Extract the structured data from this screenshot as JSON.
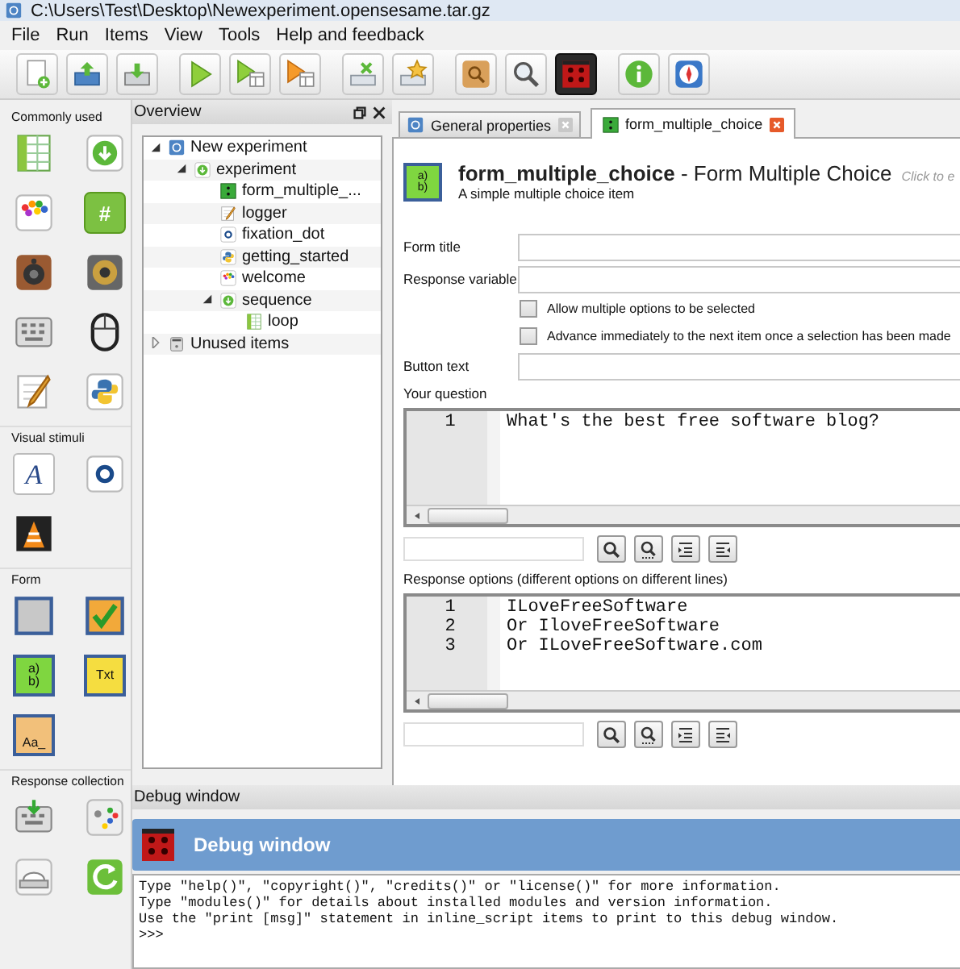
{
  "window": {
    "title": "C:\\Users\\Test\\Desktop\\Newexperiment.opensesame.tar.gz"
  },
  "menu": [
    "File",
    "Run",
    "Items",
    "View",
    "Tools",
    "Help and feedback"
  ],
  "toolbar": [
    {
      "kind": "new",
      "pressed": false
    },
    {
      "kind": "open",
      "pressed": false
    },
    {
      "kind": "save",
      "pressed": false
    },
    {
      "kind": "run",
      "pressed": false
    },
    {
      "kind": "run_window",
      "pressed": false
    },
    {
      "kind": "run_quick",
      "pressed": false
    },
    {
      "kind": "kill",
      "pressed": false
    },
    {
      "kind": "star",
      "pressed": false
    },
    {
      "kind": "folder",
      "pressed": false
    },
    {
      "kind": "search",
      "pressed": false
    },
    {
      "kind": "debug",
      "pressed": true
    },
    {
      "kind": "info",
      "pressed": false
    },
    {
      "kind": "compass",
      "pressed": false
    }
  ],
  "sidebar": {
    "sections": [
      {
        "label": "Commonly used",
        "items": [
          {
            "kind": "loop"
          },
          {
            "kind": "sequence"
          },
          {
            "kind": "sketchpad"
          },
          {
            "kind": "feedback",
            "glyph": "#"
          },
          {
            "kind": "sampler"
          },
          {
            "kind": "synth"
          },
          {
            "kind": "keyboard"
          },
          {
            "kind": "mouse"
          },
          {
            "kind": "logger"
          },
          {
            "kind": "script"
          }
        ]
      },
      {
        "label": "Visual stimuli",
        "items": [
          {
            "kind": "text",
            "glyph": "A"
          },
          {
            "kind": "fixation"
          },
          {
            "kind": "media"
          }
        ]
      },
      {
        "label": "Form",
        "items": [
          {
            "kind": "form_base"
          },
          {
            "kind": "form_check"
          },
          {
            "kind": "form_choice",
            "glyph": "a)\nb)"
          },
          {
            "kind": "form_text",
            "glyph": "Txt"
          },
          {
            "kind": "form_input",
            "glyph": "Aa_"
          }
        ]
      },
      {
        "label": "Response collection",
        "items": [
          {
            "kind": "keyboard_response"
          },
          {
            "kind": "joystick"
          },
          {
            "kind": "srbox"
          },
          {
            "kind": "reset"
          }
        ]
      }
    ]
  },
  "overview": {
    "title": "Overview",
    "tree": [
      {
        "label": "New experiment",
        "kind": "general",
        "expanded": true,
        "children": [
          {
            "label": "experiment",
            "kind": "sequence",
            "expanded": true,
            "children": [
              {
                "label": "form_multiple_...",
                "kind": "form"
              },
              {
                "label": "logger",
                "kind": "logger"
              },
              {
                "label": "fixation_dot",
                "kind": "fixation"
              },
              {
                "label": "getting_started",
                "kind": "script"
              },
              {
                "label": "welcome",
                "kind": "sketchpad"
              },
              {
                "label": "sequence",
                "kind": "sequence",
                "expanded": true,
                "children": [
                  {
                    "label": "loop",
                    "kind": "loop"
                  }
                ]
              }
            ]
          }
        ]
      },
      {
        "label": "Unused items",
        "kind": "unused",
        "expanded": false
      }
    ]
  },
  "tabs": [
    {
      "label": "General properties",
      "kind": "general",
      "selected": false
    },
    {
      "label": "form_multiple_choice",
      "kind": "form",
      "selected": true
    }
  ],
  "item_header": {
    "title": "**form_multiple_choice** - Form Multiple Choice",
    "hint": "Click to e",
    "description": "A simple multiple choice item",
    "glyph": "a)\nb)"
  },
  "fields": [
    {
      "label": "Form title"
    },
    {
      "label": "Response variable"
    }
  ],
  "checkboxes": [
    {
      "label": "Allow multiple options to be selected",
      "checked": false
    },
    {
      "label": "Advance immediately to the next item once a selection has been made",
      "checked": false
    }
  ],
  "button_text": {
    "label": "Button text"
  },
  "editors": [
    {
      "label": "Your question",
      "lines": [
        {
          "number": "1",
          "text": "What's the best free software blog?"
        }
      ]
    },
    {
      "label": "Response options (different options on different lines)",
      "lines": [
        {
          "number": "1",
          "text": "ILoveFreeSoftware"
        },
        {
          "number": "2",
          "text": "Or IloveFreeSoftware"
        },
        {
          "number": "3",
          "text": "Or ILoveFreeSoftware.com"
        }
      ]
    }
  ],
  "debug": {
    "title": "Debug window",
    "banner": "Debug window",
    "lines": [
      "Type \"help()\", \"copyright()\", \"credits()\" or \"license()\" for more information.",
      "Type \"modules()\" for details about installed modules and version information.",
      "Use the \"print [msg]\" statement in inline_script items to print to this debug window.",
      ">>>"
    ]
  }
}
